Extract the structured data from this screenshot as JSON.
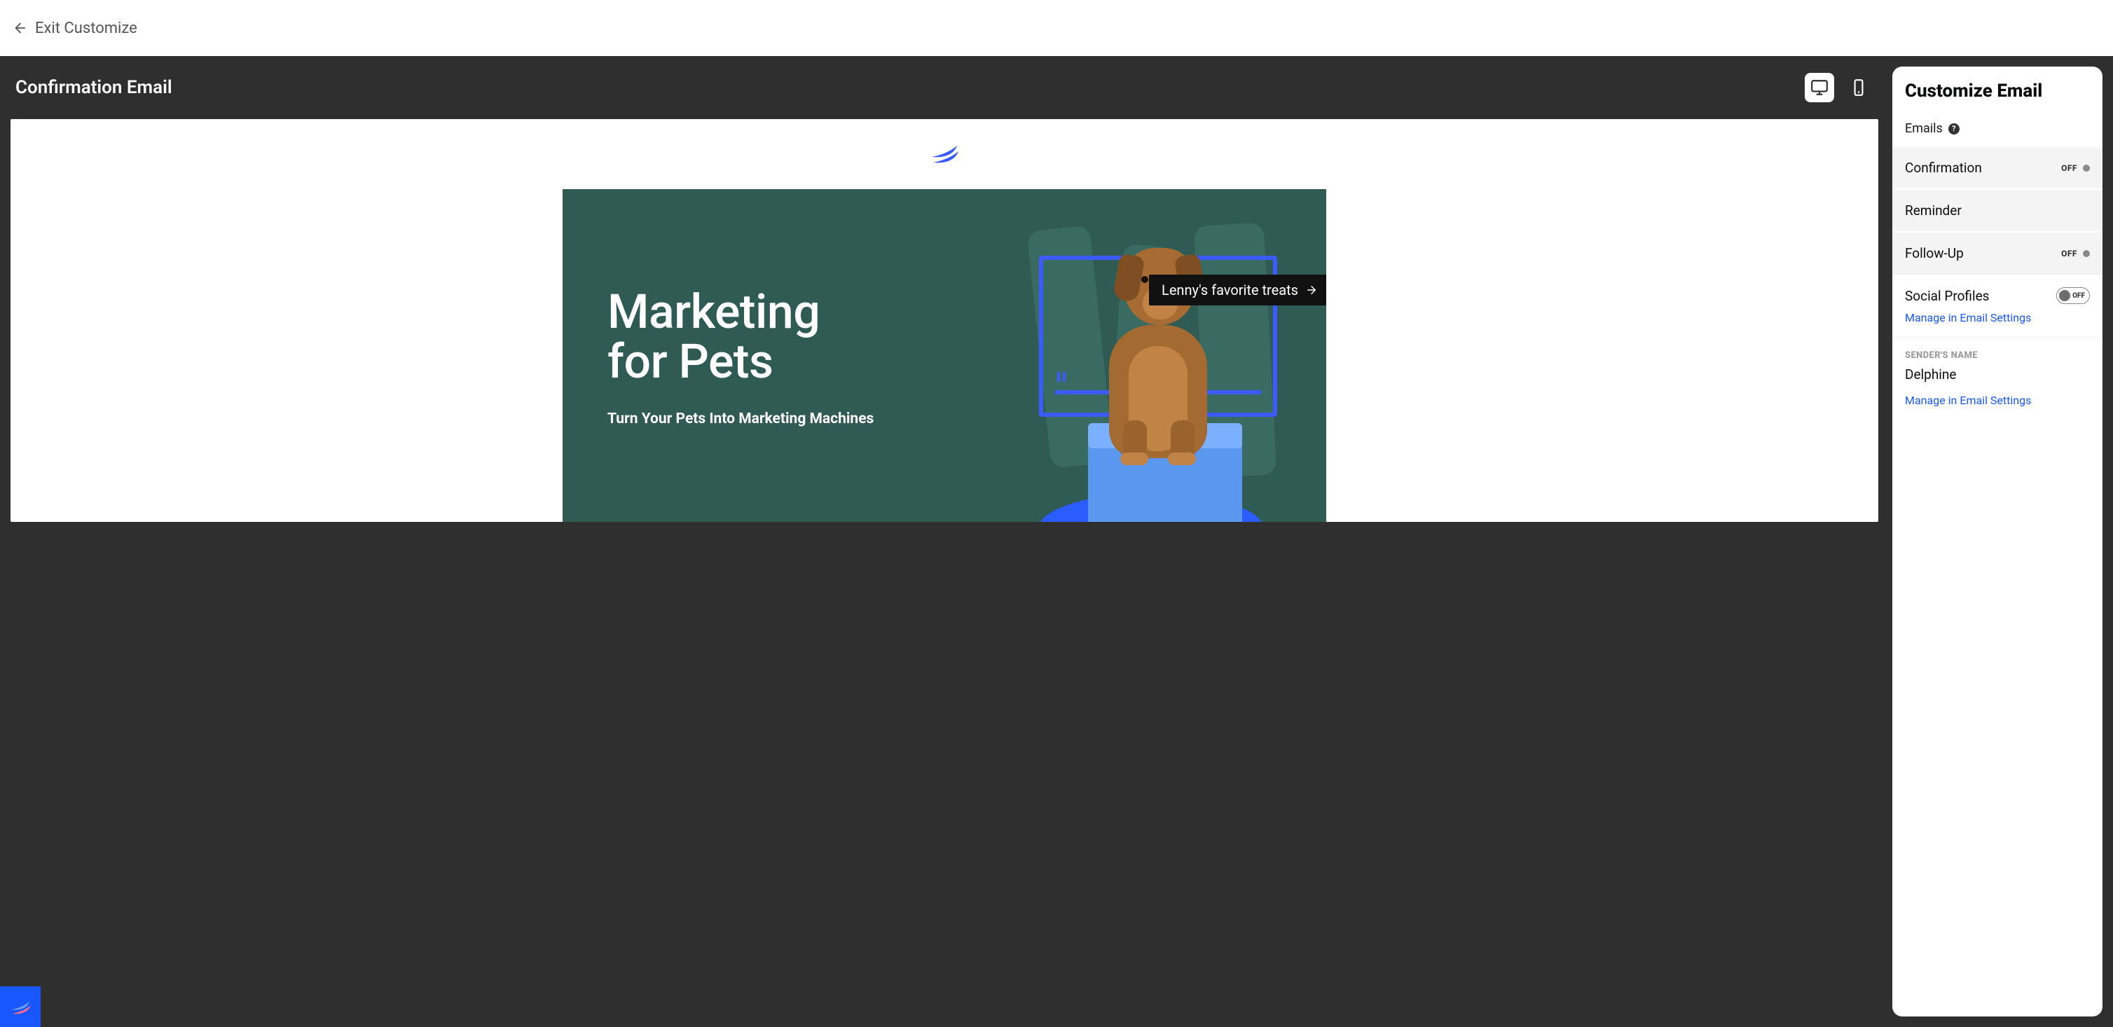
{
  "topbar": {
    "exit_label": "Exit Customize"
  },
  "preview": {
    "title": "Confirmation Email",
    "hero_line1": "Marketing",
    "hero_line2": "for Pets",
    "hero_sub": "Turn Your Pets Into Marketing Machines",
    "treats_label": "Lenny's favorite treats"
  },
  "panel": {
    "title": "Customize Email",
    "emails_label": "Emails",
    "rows": {
      "confirmation": {
        "label": "Confirmation",
        "status": "OFF"
      },
      "reminder": {
        "label": "Reminder"
      },
      "followup": {
        "label": "Follow-Up",
        "status": "OFF"
      }
    },
    "social": {
      "title": "Social Profiles",
      "manage": "Manage in Email Settings",
      "toggle_label": "OFF"
    },
    "sender": {
      "section": "SENDER'S NAME",
      "name": "Delphine",
      "manage": "Manage in Email Settings"
    }
  },
  "colors": {
    "accent_blue": "#1857ff",
    "hero_bg": "#2f5b54"
  }
}
